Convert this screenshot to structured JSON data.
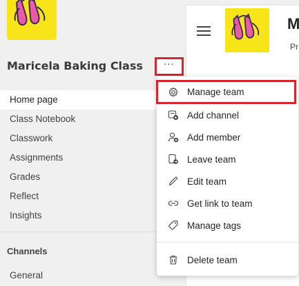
{
  "sidebar": {
    "team_name": "Maricela Baking Class",
    "more_label": "···",
    "nav": [
      {
        "label": "Home page",
        "active": true
      },
      {
        "label": "Class Notebook"
      },
      {
        "label": "Classwork"
      },
      {
        "label": "Assignments"
      },
      {
        "label": "Grades"
      },
      {
        "label": "Reflect"
      },
      {
        "label": "Insights"
      }
    ],
    "channels_title": "Channels",
    "channels": [
      "General"
    ]
  },
  "header": {
    "title": "M",
    "subtitle": "Pr"
  },
  "menu": {
    "items": [
      {
        "label": "Manage team",
        "icon": "gear-icon"
      },
      {
        "label": "Add channel",
        "icon": "add-channel-icon"
      },
      {
        "label": "Add member",
        "icon": "add-member-icon"
      },
      {
        "label": "Leave team",
        "icon": "leave-team-icon"
      },
      {
        "label": "Edit team",
        "icon": "pencil-icon"
      },
      {
        "label": "Get link to team",
        "icon": "link-icon"
      },
      {
        "label": "Manage tags",
        "icon": "tag-icon"
      },
      {
        "label": "Delete team",
        "icon": "trash-icon"
      }
    ]
  },
  "colors": {
    "highlight_border": "#d5262f",
    "avatar_bg": "#f7e51a",
    "shoe_pink": "#e95aa7",
    "shoe_dark": "#3a2a55"
  }
}
